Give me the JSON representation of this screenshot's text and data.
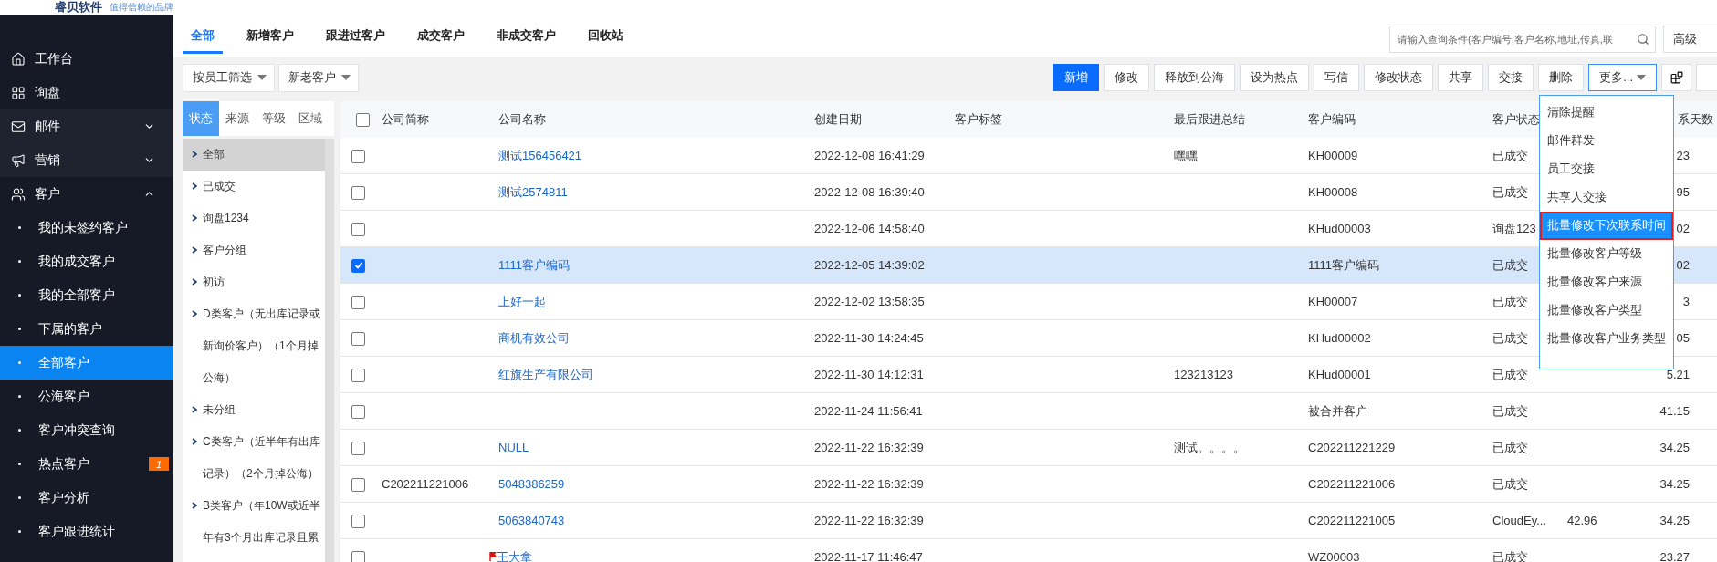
{
  "header": {
    "logo": "睿贝软件",
    "tagline": "值得信赖的品牌"
  },
  "sidebar": {
    "items": [
      {
        "kind": "link",
        "label": "工作台"
      },
      {
        "kind": "link",
        "label": "询盘"
      },
      {
        "kind": "group",
        "label": "邮件",
        "expanded": false
      },
      {
        "kind": "group",
        "label": "营销",
        "expanded": false
      },
      {
        "kind": "group",
        "label": "客户",
        "expanded": true,
        "children": [
          {
            "label": "我的未签约客户",
            "selected": false
          },
          {
            "label": "我的成交客户",
            "selected": false
          },
          {
            "label": "我的全部客户",
            "selected": false
          },
          {
            "label": "下属的客户",
            "selected": false
          },
          {
            "label": "全部客户",
            "selected": true
          },
          {
            "label": "公海客户",
            "selected": false
          },
          {
            "label": "客户冲突查询",
            "selected": false
          },
          {
            "label": "热点客户",
            "selected": false,
            "badge": "1"
          },
          {
            "label": "客户分析",
            "selected": false
          },
          {
            "label": "客户跟进统计",
            "selected": false
          }
        ]
      }
    ]
  },
  "tabs": [
    {
      "label": "全部",
      "selected": true
    },
    {
      "label": "新增客户",
      "selected": false
    },
    {
      "label": "跟进过客户",
      "selected": false
    },
    {
      "label": "成交客户",
      "selected": false
    },
    {
      "label": "非成交客户",
      "selected": false
    },
    {
      "label": "回收站",
      "selected": false
    }
  ],
  "search": {
    "placeholder": "请输入查询条件(客户编号,客户名称,地址,传真,联",
    "advanced_button": "高级"
  },
  "filters": [
    {
      "label": "按员工筛选"
    },
    {
      "label": "新老客户"
    }
  ],
  "actions": [
    {
      "kind": "primary",
      "label": "新增"
    },
    {
      "kind": "default",
      "label": "修改"
    },
    {
      "kind": "default",
      "label": "释放到公海"
    },
    {
      "kind": "default",
      "label": "设为热点"
    },
    {
      "kind": "default",
      "label": "写信"
    },
    {
      "kind": "default",
      "label": "修改状态"
    },
    {
      "kind": "default",
      "label": "共享"
    },
    {
      "kind": "default",
      "label": "交接"
    },
    {
      "kind": "default",
      "label": "删除"
    },
    {
      "kind": "menu",
      "label": "更多..."
    }
  ],
  "more_menu": {
    "items": [
      {
        "label": "清除提醒",
        "selected": false
      },
      {
        "label": "邮件群发",
        "selected": false
      },
      {
        "label": "员工交接",
        "selected": false
      },
      {
        "label": "共享人交接",
        "selected": false
      },
      {
        "label": "批量修改下次联系时间",
        "selected": true
      },
      {
        "label": "批量修改客户等级",
        "selected": false
      },
      {
        "label": "批量修改客户来源",
        "selected": false
      },
      {
        "label": "批量修改客户类型",
        "selected": false
      },
      {
        "label": "批量修改客户业务类型",
        "selected": false
      }
    ]
  },
  "filter_panel": {
    "tabs": [
      {
        "label": "状态",
        "selected": true
      },
      {
        "label": "来源",
        "selected": false
      },
      {
        "label": "等级",
        "selected": false
      },
      {
        "label": "区域",
        "selected": false
      }
    ],
    "items": [
      {
        "label": "全部",
        "selected": true
      },
      {
        "label": "已成交",
        "selected": false
      },
      {
        "label": "询盘1234",
        "selected": false
      },
      {
        "label": "客户分组",
        "selected": false
      },
      {
        "label": "初访",
        "selected": false
      },
      {
        "label": "D类客户（无出库记录或新询价客户）（1个月掉公海）",
        "selected": false
      },
      {
        "label": "未分组",
        "selected": false
      },
      {
        "label": "C类客户（近半年有出库记录）（2个月掉公海）",
        "selected": false
      },
      {
        "label": "B类客户（年10W或近半年有3个月出库记录且累",
        "selected": false
      }
    ]
  },
  "table": {
    "header_checked": false,
    "columns": [
      {
        "kind": "text",
        "label": "公司简称"
      },
      {
        "kind": "link",
        "label": "公司名称"
      },
      {
        "kind": "text",
        "label": "创建日期"
      },
      {
        "kind": "text",
        "label": "客户标签"
      },
      {
        "kind": "text",
        "label": "最后跟进总结"
      },
      {
        "kind": "text",
        "label": "客户编码"
      },
      {
        "kind": "text",
        "label": "客户状态"
      },
      {
        "kind": "text"
      },
      {
        "kind": "number",
        "label": "系天数"
      }
    ],
    "rows": [
      {
        "checked": false,
        "flagged": false,
        "cells": [
          null,
          "测试156456421",
          "2022-12-08 16:41:29",
          null,
          "嘿嘿",
          "KH00009",
          "已成交",
          null,
          "23"
        ]
      },
      {
        "checked": false,
        "flagged": false,
        "cells": [
          null,
          "测试2574811",
          "2022-12-08 16:39:40",
          null,
          null,
          "KH00008",
          "已成交",
          null,
          "95"
        ]
      },
      {
        "checked": false,
        "flagged": false,
        "cells": [
          null,
          null,
          "2022-12-06 14:58:40",
          null,
          null,
          "KHud00003",
          "询盘123",
          null,
          "02"
        ]
      },
      {
        "checked": true,
        "flagged": false,
        "cells": [
          null,
          "1111客户编码",
          "2022-12-05 14:39:02",
          null,
          null,
          "1111客户编码",
          "已成交",
          null,
          "02"
        ]
      },
      {
        "checked": false,
        "flagged": false,
        "cells": [
          null,
          "上好一起",
          "2022-12-02 13:58:35",
          null,
          null,
          "KH00007",
          "已成交",
          null,
          "3"
        ]
      },
      {
        "checked": false,
        "flagged": false,
        "cells": [
          null,
          "商机有效公司",
          "2022-11-30 14:24:45",
          null,
          null,
          "KHud00002",
          "已成交",
          null,
          "05"
        ]
      },
      {
        "checked": false,
        "flagged": false,
        "cells": [
          null,
          "红旗生产有限公司",
          "2022-11-30 14:12:31",
          null,
          "123213123",
          "KHud00001",
          "已成交",
          null,
          "5.21"
        ]
      },
      {
        "checked": false,
        "flagged": false,
        "cells": [
          null,
          null,
          "2022-11-24 11:56:41",
          null,
          null,
          "被合并客户",
          "已成交",
          null,
          "41.15"
        ]
      },
      {
        "checked": false,
        "flagged": false,
        "cells": [
          null,
          "NULL",
          "2022-11-22 16:32:39",
          null,
          "测试。。。。",
          "C202211221229",
          "已成交",
          null,
          "34.25"
        ]
      },
      {
        "checked": false,
        "flagged": false,
        "cells": [
          "C202211221006",
          "5048386259",
          "2022-11-22 16:32:39",
          null,
          null,
          "C202211221006",
          "已成交",
          null,
          "34.25"
        ]
      },
      {
        "checked": false,
        "flagged": false,
        "cells": [
          null,
          "5063840743",
          "2022-11-22 16:32:39",
          null,
          null,
          "C202211221005",
          "CloudEy...",
          "42.96",
          "34.25"
        ]
      },
      {
        "checked": false,
        "flagged": true,
        "cells": [
          null,
          "王大拿",
          "2022-11-17 11:46:47",
          null,
          null,
          "WZ00003",
          "已成交",
          null,
          "23.27"
        ]
      }
    ]
  }
}
